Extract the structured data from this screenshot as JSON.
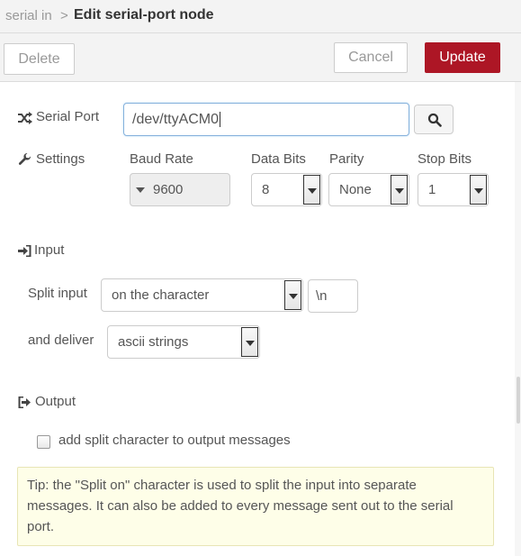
{
  "breadcrumb": {
    "parent": "serial in",
    "separator": ">",
    "title": "Edit serial-port node"
  },
  "toolbar": {
    "delete_label": "Delete",
    "cancel_label": "Cancel",
    "update_label": "Update"
  },
  "serial_port": {
    "label": "Serial Port",
    "value": "/dev/ttyACM0",
    "icon": "shuffle-icon",
    "search_icon": "search-icon"
  },
  "settings": {
    "label": "Settings",
    "icon": "wrench-icon",
    "baud_rate": {
      "label": "Baud Rate",
      "value": "9600"
    },
    "data_bits": {
      "label": "Data Bits",
      "value": "8"
    },
    "parity": {
      "label": "Parity",
      "value": "None"
    },
    "stop_bits": {
      "label": "Stop Bits",
      "value": "1"
    }
  },
  "input_section": {
    "label": "Input",
    "icon": "sign-in-icon",
    "split_label": "Split input",
    "split_value": "on the character",
    "split_char": "\\n",
    "deliver_label": "and deliver",
    "deliver_value": "ascii strings"
  },
  "output_section": {
    "label": "Output",
    "icon": "sign-out-icon",
    "checkbox_label": "add split character to output messages",
    "checkbox_checked": false
  },
  "tip": {
    "line1": "Tip: the \"Split on\" character is used to split the input into separate",
    "line2": "messages. It can also be added to every message sent out to the serial",
    "line3": "port."
  },
  "colors": {
    "accent": "#ad1625",
    "header_bg": "#f3f3f3",
    "tip_bg": "#fefee8"
  }
}
